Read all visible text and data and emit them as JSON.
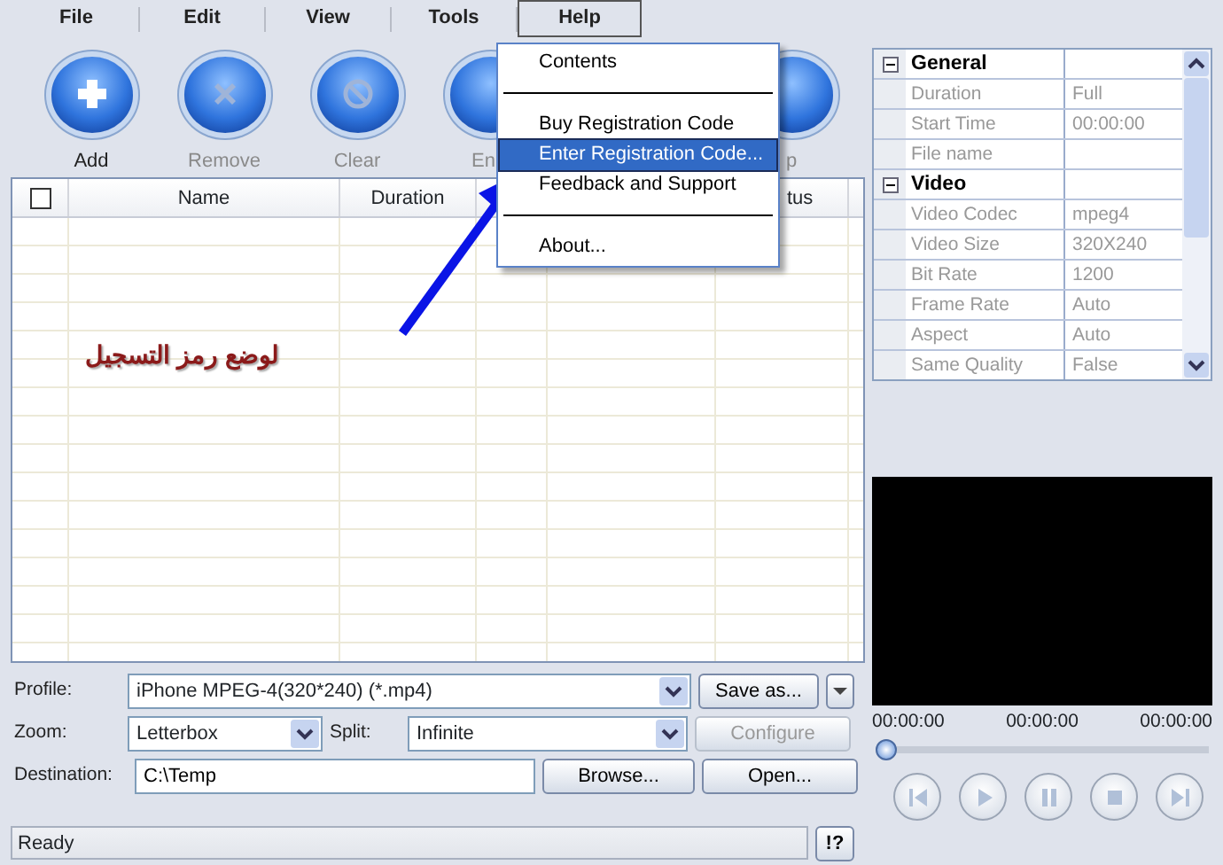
{
  "menu_bar": [
    {
      "label": "File",
      "selected": false
    },
    {
      "label": "Edit",
      "selected": false
    },
    {
      "label": "View",
      "selected": false
    },
    {
      "label": "Tools",
      "selected": false
    },
    {
      "label": "Help",
      "selected": true
    }
  ],
  "help_menu": [
    {
      "kind": "item",
      "label": "Contents",
      "selected": false
    },
    {
      "kind": "separator"
    },
    {
      "kind": "item",
      "label": "Buy Registration Code",
      "selected": false
    },
    {
      "kind": "item",
      "label": "Enter Registration Code...",
      "selected": true
    },
    {
      "kind": "item",
      "label": "Feedback and Support",
      "selected": false
    },
    {
      "kind": "separator"
    },
    {
      "kind": "item",
      "label": "About...",
      "selected": false
    }
  ],
  "toolbar": [
    {
      "kind": "add",
      "label": "Add",
      "disabled": false
    },
    {
      "kind": "remove",
      "label": "Remove",
      "disabled": true
    },
    {
      "kind": "clear",
      "label": "Clear",
      "disabled": true
    },
    {
      "kind": "covered",
      "label": "En",
      "disabled": true
    },
    {
      "kind": "covered",
      "label": "p",
      "disabled": true
    }
  ],
  "table": {
    "header_checked": false,
    "columns": [
      {
        "label": "Name"
      },
      {
        "label": "Duration"
      },
      {},
      {},
      {
        "label": "tus"
      }
    ]
  },
  "annotation": {
    "text": "لوضع رمز التسجيل"
  },
  "form": {
    "profile_label": "Profile:",
    "profile": "iPhone MPEG-4(320*240)  (*.mp4)",
    "save_as": "Save as...",
    "zoom_label": "Zoom:",
    "zoom": "Letterbox",
    "split_label": "Split:",
    "split": "Infinite",
    "configure": "Configure",
    "configure_disabled": true,
    "destination_label": "Destination:",
    "destination": "C:\\Temp",
    "browse": "Browse...",
    "open": "Open..."
  },
  "status_bar": {
    "text": "Ready",
    "help": "!?"
  },
  "properties": [
    {
      "category": "General",
      "expanded": true,
      "rows": [
        {
          "name": "Duration",
          "value": "Full"
        },
        {
          "name": "Start Time",
          "value": "00:00:00"
        },
        {
          "name": "File name"
        }
      ]
    },
    {
      "category": "Video",
      "expanded": true,
      "rows": [
        {
          "name": "Video Codec",
          "value": "mpeg4"
        },
        {
          "name": "Video Size",
          "value": "320X240"
        },
        {
          "name": "Bit Rate",
          "value": "1200"
        },
        {
          "name": "Frame Rate",
          "value": "Auto"
        },
        {
          "name": "Aspect",
          "value": "Auto"
        },
        {
          "name": "Same Quality",
          "value": "False"
        }
      ]
    }
  ],
  "player": {
    "times": [
      "00:00:00",
      "00:00:00",
      "00:00:00"
    ],
    "level": 0,
    "controls": [
      {
        "kind": "previous"
      },
      {
        "kind": "play"
      },
      {
        "kind": "pause"
      },
      {
        "kind": "stop"
      },
      {
        "kind": "next"
      }
    ]
  }
}
